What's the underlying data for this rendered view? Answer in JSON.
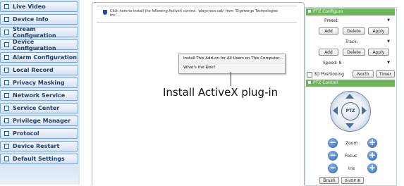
{
  "sidebar": {
    "items": [
      {
        "label": "Live Video"
      },
      {
        "label": "Device Info"
      },
      {
        "label": "Stream Configuration"
      },
      {
        "label": "Device Configuration"
      },
      {
        "label": "Alarm Configuration"
      },
      {
        "label": "Local Record"
      },
      {
        "label": "Privacy Masking"
      },
      {
        "label": "Network Service"
      },
      {
        "label": "Service Center"
      },
      {
        "label": "Privilege Manager"
      },
      {
        "label": "Protocol"
      },
      {
        "label": "Device Restart"
      },
      {
        "label": "Default Settings"
      }
    ]
  },
  "infobar": {
    "message": "Click here to install the following ActiveX control: 'playerocx.cab' from 'Digimerge Technologies Inc.'..."
  },
  "context_menu": {
    "items": [
      {
        "label": "Install This Add-on for All Users on This Computer..."
      },
      {
        "label": "What's the Risk?"
      }
    ]
  },
  "caption": "Install ActiveX plug-in",
  "ptz": {
    "configure_title": "PTZ Configure",
    "preset_label": "Preset:",
    "add_label": "Add",
    "delete_label": "Delete",
    "apply_label": "Apply",
    "track_label": "Track:",
    "speed_label": "Speed: 8",
    "positioning_label": "3D Positioning",
    "north_label": "North",
    "timer_label": "Timer",
    "control_title": "PTZ Control",
    "center_label": "PTZ",
    "zoom_label": "Zoom",
    "focus_label": "Focus",
    "iris_label": "Iris",
    "brush_label": "Brush",
    "ir_label": "On/Off IR",
    "minus_glyph": "−",
    "plus_glyph": "+"
  },
  "colors": {
    "accent_header": "#6db55a",
    "sidebar_text": "#1f3f6a",
    "zoom_buttons": "#2d63b6"
  }
}
